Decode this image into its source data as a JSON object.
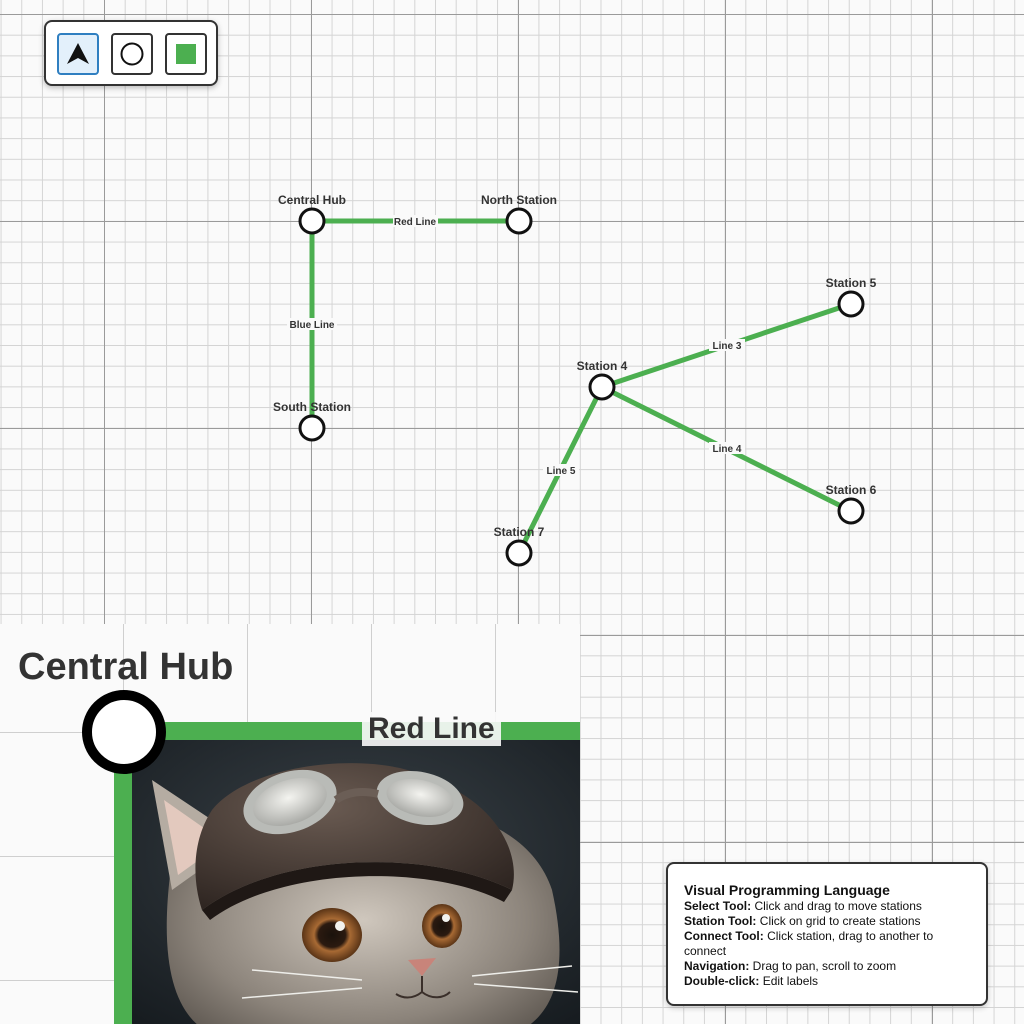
{
  "toolbar": {
    "tools": [
      {
        "name": "Select Tool",
        "icon": "arrow-cursor-icon",
        "active": true
      },
      {
        "name": "Station Tool",
        "icon": "circle-icon",
        "active": false
      },
      {
        "name": "Connect Tool",
        "icon": "green-square-icon",
        "active": false
      }
    ]
  },
  "map": {
    "colors": {
      "line": "#4caf50",
      "station_stroke": "#111111",
      "station_fill": "#ffffff"
    },
    "stations": {
      "central_hub": "Central Hub",
      "north_station": "North Station",
      "south_station": "South Station",
      "station_4": "Station 4",
      "station_5": "Station 5",
      "station_6": "Station 6",
      "station_7": "Station 7"
    },
    "lines": {
      "red_line": "Red Line",
      "blue_line": "Blue Line",
      "line_3": "Line 3",
      "line_4": "Line 4",
      "line_5": "Line 5"
    }
  },
  "zoom_view": {
    "station_label": "Central Hub",
    "line_label": "Red Line",
    "photo_subject": "cat wearing aviator helmet with goggles"
  },
  "help": {
    "title": "Visual Programming Language",
    "items": [
      {
        "key": "Select Tool:",
        "text": " Click and drag to move stations"
      },
      {
        "key": "Station Tool:",
        "text": " Click on grid to create stations"
      },
      {
        "key": "Connect Tool:",
        "text": " Click station, drag to another to connect"
      },
      {
        "key": "Navigation:",
        "text": " Drag to pan, scroll to zoom"
      },
      {
        "key": "Double-click:",
        "text": " Edit labels"
      }
    ]
  }
}
